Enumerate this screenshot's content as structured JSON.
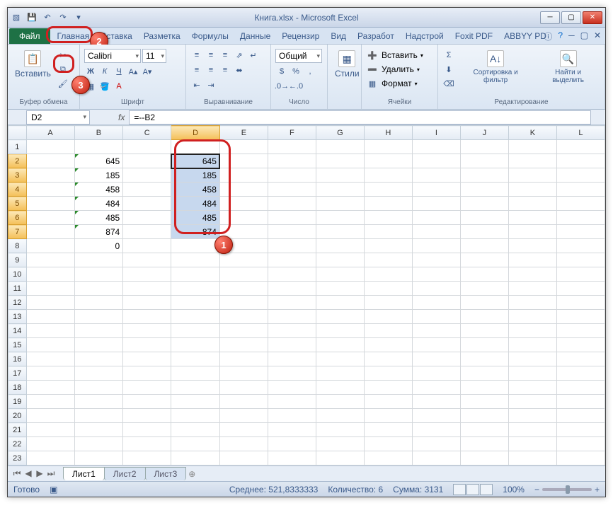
{
  "title": "Книга.xlsx - Microsoft Excel",
  "tabs": {
    "file": "Файл",
    "home": "Главная",
    "insert": "Вставка",
    "layout": "Разметка",
    "formulas": "Формулы",
    "data": "Данные",
    "review": "Рецензир",
    "view": "Вид",
    "dev": "Разработ",
    "addins": "Надстрой",
    "foxit": "Foxit PDF",
    "abbyy": "ABBYY PD"
  },
  "ribbon": {
    "clipboard": {
      "label": "Буфер обмена",
      "paste": "Вставить"
    },
    "font": {
      "label": "Шрифт",
      "name": "Calibri",
      "size": "11"
    },
    "alignment": {
      "label": "Выравнивание"
    },
    "number": {
      "label": "Число",
      "general": "Общий"
    },
    "styles": {
      "label": "Стили",
      "btn": "Стили"
    },
    "cells": {
      "label": "Ячейки",
      "insert": "Вставить",
      "delete": "Удалить",
      "format": "Формат"
    },
    "editing": {
      "label": "Редактирование",
      "sort": "Сортировка и фильтр",
      "find": "Найти и выделить"
    }
  },
  "namebox": "D2",
  "formula": "=--B2",
  "columns": [
    "A",
    "B",
    "C",
    "D",
    "E",
    "F",
    "G",
    "H",
    "I",
    "J",
    "K",
    "L"
  ],
  "rows_shown": 23,
  "data_b": {
    "2": "645",
    "3": "185",
    "4": "458",
    "5": "484",
    "6": "485",
    "7": "874",
    "8": "0"
  },
  "data_d": {
    "2": "645",
    "3": "185",
    "4": "458",
    "5": "484",
    "6": "485",
    "7": "874"
  },
  "selection": {
    "col": "D",
    "rows": [
      2,
      3,
      4,
      5,
      6,
      7
    ]
  },
  "sheets": [
    "Лист1",
    "Лист2",
    "Лист3"
  ],
  "status": {
    "ready": "Готово",
    "avg_label": "Среднее:",
    "avg": "521,8333333",
    "count_label": "Количество:",
    "count": "6",
    "sum_label": "Сумма:",
    "sum": "3131",
    "zoom": "100%"
  },
  "callouts": {
    "1": "1",
    "2": "2",
    "3": "3"
  }
}
